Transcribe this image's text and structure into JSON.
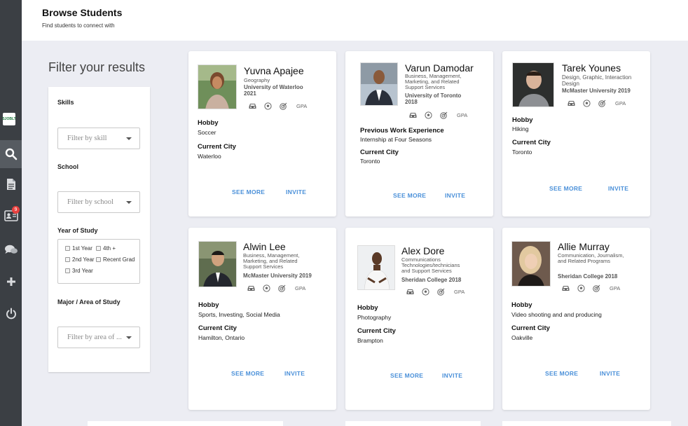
{
  "header": {
    "title": "Browse Students",
    "subtitle": "Find students to connect with"
  },
  "sidebar": {
    "logo_text": "SJOBLT",
    "notification_count": "9",
    "icons": [
      "logo-icon",
      "search-icon",
      "document-icon",
      "contact-card-icon",
      "chat-icon",
      "plus-icon",
      "power-icon"
    ]
  },
  "filter": {
    "heading": "Filter your results",
    "skills_label": "Skills",
    "skills_placeholder": "Filter by skill",
    "school_label": "School",
    "school_placeholder": "Filter by school",
    "year_label": "Year of Study",
    "year_options": [
      "1st Year",
      "4th +",
      "2nd Year",
      "Recent Grad",
      "3rd Year"
    ],
    "major_label": "Major / Area of Study",
    "major_placeholder": "Filter by area of ..."
  },
  "card_actions": {
    "see_more": "SEE MORE",
    "invite": "INVITE",
    "gpa": "GPA"
  },
  "students": [
    {
      "name": "Yuvna Apajee",
      "major": "Geography",
      "school": "University of Waterloo 2021",
      "sections": [
        {
          "label": "Hobby",
          "value": "Soccer"
        },
        {
          "label": "Current City",
          "value": "Waterloo"
        }
      ]
    },
    {
      "name": "Varun Damodar",
      "major": "Business, Management, Marketing, and Related Support Services",
      "school": "University of Toronto 2018",
      "sections": [
        {
          "label": "Previous Work Experience",
          "value": "Internship at Four Seasons"
        },
        {
          "label": "Current City",
          "value": "Toronto"
        }
      ]
    },
    {
      "name": "Tarek Younes",
      "major": "Design, Graphic, Interaction Design",
      "school": "McMaster University 2019",
      "sections": [
        {
          "label": "Hobby",
          "value": "Hiking"
        },
        {
          "label": "Current City",
          "value": "Toronto"
        }
      ]
    },
    {
      "name": "Alwin Lee",
      "major": "Business, Management, Marketing, and Related Support Services",
      "school": "McMaster University 2019",
      "sections": [
        {
          "label": "Hobby",
          "value": "Sports, Investing, Social Media"
        },
        {
          "label": "Current City",
          "value": "Hamilton, Ontario"
        }
      ]
    },
    {
      "name": "Alex Dore",
      "major": "Communications Technologies/technicians and Support Services",
      "school": "Sheridan College 2018",
      "sections": [
        {
          "label": "Hobby",
          "value": "Photography"
        },
        {
          "label": "Current City",
          "value": "Brampton"
        }
      ]
    },
    {
      "name": "Allie Murray",
      "major": "Communication, Journalism, and Related Programs",
      "school": "Sheridan College 2018",
      "sections": [
        {
          "label": "Hobby",
          "value": "Video shooting and and producing"
        },
        {
          "label": "Current City",
          "value": "Oakville"
        }
      ]
    }
  ]
}
